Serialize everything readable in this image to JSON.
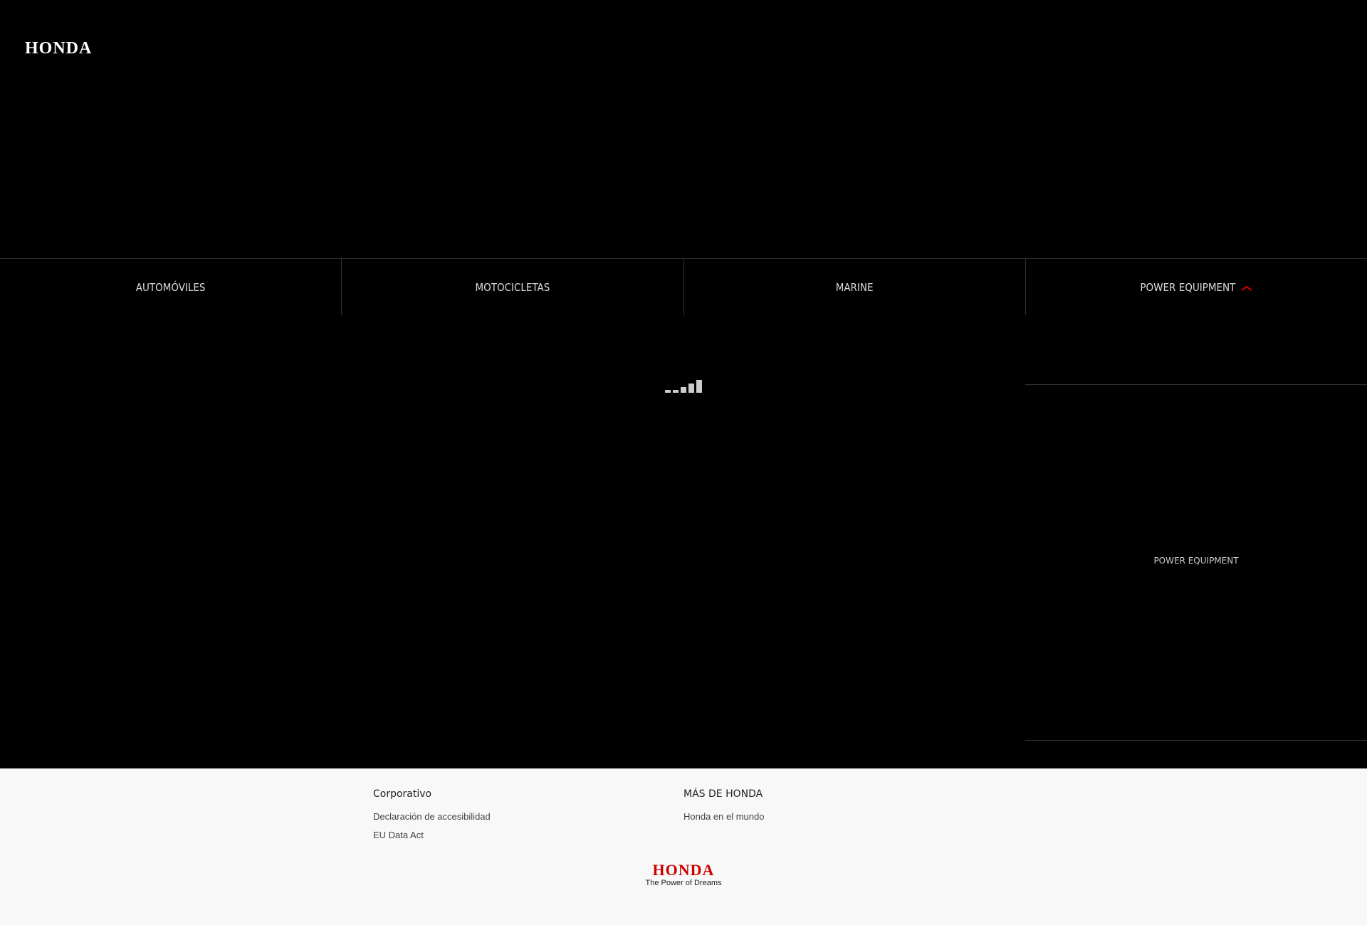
{
  "header": {
    "logo": "HONDA"
  },
  "nav": {
    "tabs": [
      {
        "label": "AUTOMÓVILES"
      },
      {
        "label": "MOTOCICLETAS"
      },
      {
        "label": "MARINE"
      },
      {
        "label": "POWER EQUIPMENT"
      }
    ]
  },
  "panel": {
    "power_equipment_label": "POWER EQUIPMENT"
  },
  "footer": {
    "columns": [
      {
        "heading": "Corporativo",
        "links": [
          "Declaración de accesibilidad",
          "EU Data Act"
        ]
      },
      {
        "heading": "MÁS DE HONDA",
        "links": [
          "Honda en el mundo"
        ]
      }
    ],
    "logo": {
      "brand": "HONDA",
      "tagline": "The Power of Dreams"
    }
  },
  "colors": {
    "background": "#000000",
    "footer_bg": "#f8f8f8",
    "accent": "#cc0000"
  }
}
